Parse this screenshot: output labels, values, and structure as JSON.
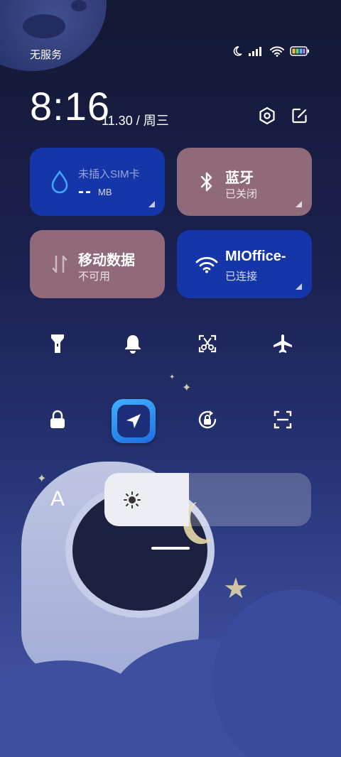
{
  "status_bar": {
    "carrier": "无服务",
    "icons": [
      "moon-icon",
      "signal-icon",
      "wifi-icon",
      "battery-icon"
    ]
  },
  "header": {
    "time": "8:16",
    "date": "11.30 / 周三",
    "buttons": [
      "settings-icon",
      "edit-icon"
    ]
  },
  "tiles": {
    "sim": {
      "title": "未插入SIM卡",
      "value": "--",
      "unit": "MB"
    },
    "bluetooth": {
      "title": "蓝牙",
      "status": "已关闭"
    },
    "mobile_data": {
      "title": "移动数据",
      "status": "不可用"
    },
    "wifi": {
      "title": "MIOffice-",
      "status": "已连接"
    }
  },
  "toggles_row1": [
    "flashlight-icon",
    "bell-icon",
    "screenshot-icon",
    "airplane-icon"
  ],
  "toggles_row2": [
    "lock-icon",
    "location-app-icon",
    "rotation-lock-icon",
    "scan-icon"
  ],
  "brightness": {
    "auto_label": "A",
    "level": 0.41
  },
  "colors": {
    "tile_blue": "#1536a8",
    "tile_pink": "#906a7a"
  }
}
